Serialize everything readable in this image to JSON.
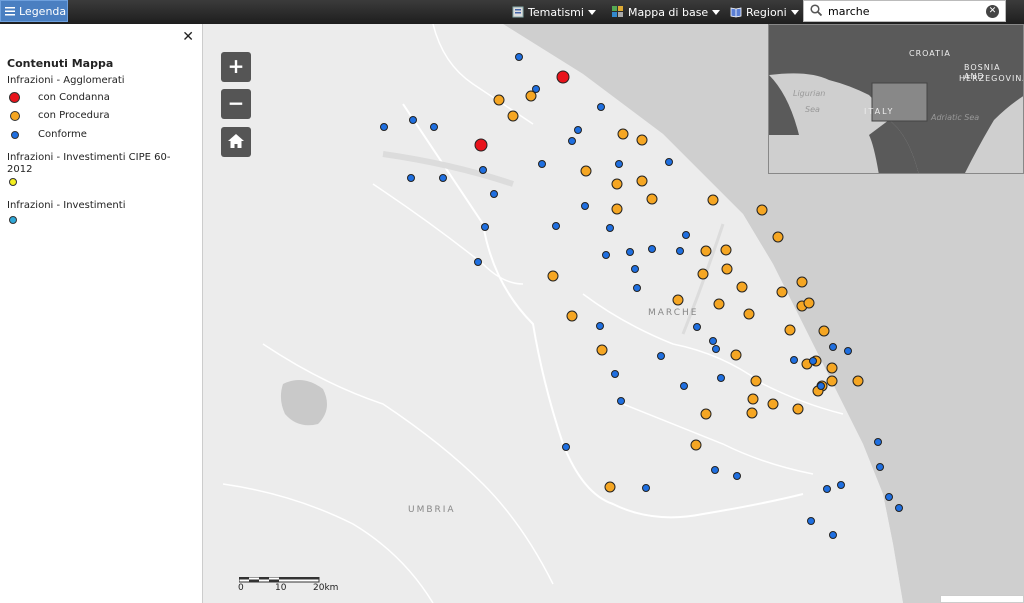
{
  "toolbar": {
    "legend_label": "Legenda",
    "tematismi_label": "Tematismi",
    "mappa_label": "Mappa di base",
    "regioni_label": "Regioni",
    "search_value": "marche",
    "clear_glyph": "✕"
  },
  "legend_panel": {
    "close_glyph": "✕",
    "title": "Contenuti Mappa",
    "groups": [
      {
        "title": "Infrazioni - Agglomerati",
        "items": [
          {
            "label": "con Condanna",
            "color": "#e8131b"
          },
          {
            "label": "con Procedura",
            "color": "#f5a623"
          },
          {
            "label": "Conforme",
            "color": "#1f6fe0"
          }
        ]
      },
      {
        "title": "Infrazioni - Investimenti CIPE 60-2012",
        "items": [
          {
            "label": "",
            "color": "#f3ee20"
          }
        ]
      },
      {
        "title": "Infrazioni - Investimenti",
        "items": [
          {
            "label": "",
            "color": "#2fa8d8"
          }
        ]
      }
    ]
  },
  "map": {
    "zoom_in": "+",
    "zoom_out": "−",
    "region_labels": [
      "MARCHE",
      "UMBRIA"
    ],
    "overview_labels": [
      "CROATIA",
      "BOSNIA AND",
      "HERZEGOVINA",
      "Ligurian",
      "Sea",
      "ITALY",
      "Adriatic Sea"
    ],
    "scale_labels": [
      "0",
      "10",
      "20km"
    ],
    "colors": {
      "condanna": "#e8131b",
      "procedura": "#f5a623",
      "conforme": "#1f6fe0"
    }
  }
}
